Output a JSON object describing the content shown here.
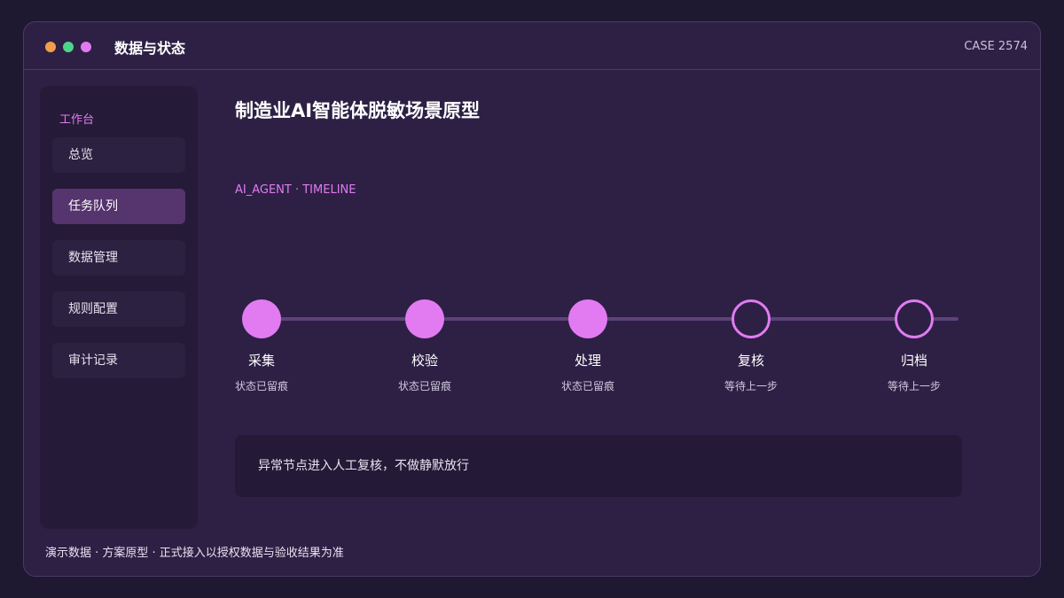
{
  "window": {
    "title": "数据与状态",
    "case_id": "CASE 2574",
    "traffic_light_colors": [
      "#f29d4b",
      "#4ed48a",
      "#e27bf2"
    ]
  },
  "sidebar": {
    "heading": "工作台",
    "items": [
      {
        "label": "总览",
        "active": false
      },
      {
        "label": "任务队列",
        "active": true
      },
      {
        "label": "数据管理",
        "active": false
      },
      {
        "label": "规则配置",
        "active": false
      },
      {
        "label": "审计记录",
        "active": false
      }
    ]
  },
  "main": {
    "title": "制造业AI智能体脱敏场景原型",
    "subtitle": "AI_AGENT · TIMELINE",
    "timeline": [
      {
        "label": "采集",
        "status": "状态已留痕",
        "completed": true
      },
      {
        "label": "校验",
        "status": "状态已留痕",
        "completed": true
      },
      {
        "label": "处理",
        "status": "状态已留痕",
        "completed": true
      },
      {
        "label": "复核",
        "status": "等待上一步",
        "completed": false
      },
      {
        "label": "归档",
        "status": "等待上一步",
        "completed": false
      }
    ],
    "notice": "异常节点进入人工复核，不做静默放行"
  },
  "footer": "演示数据 · 方案原型 · 正式接入以授权数据与验收结果为准",
  "colors": {
    "accent": "#e27bf2",
    "background": "#1e1830",
    "window": "#2d2044",
    "panel": "#251b38",
    "active_item": "#56346e"
  }
}
